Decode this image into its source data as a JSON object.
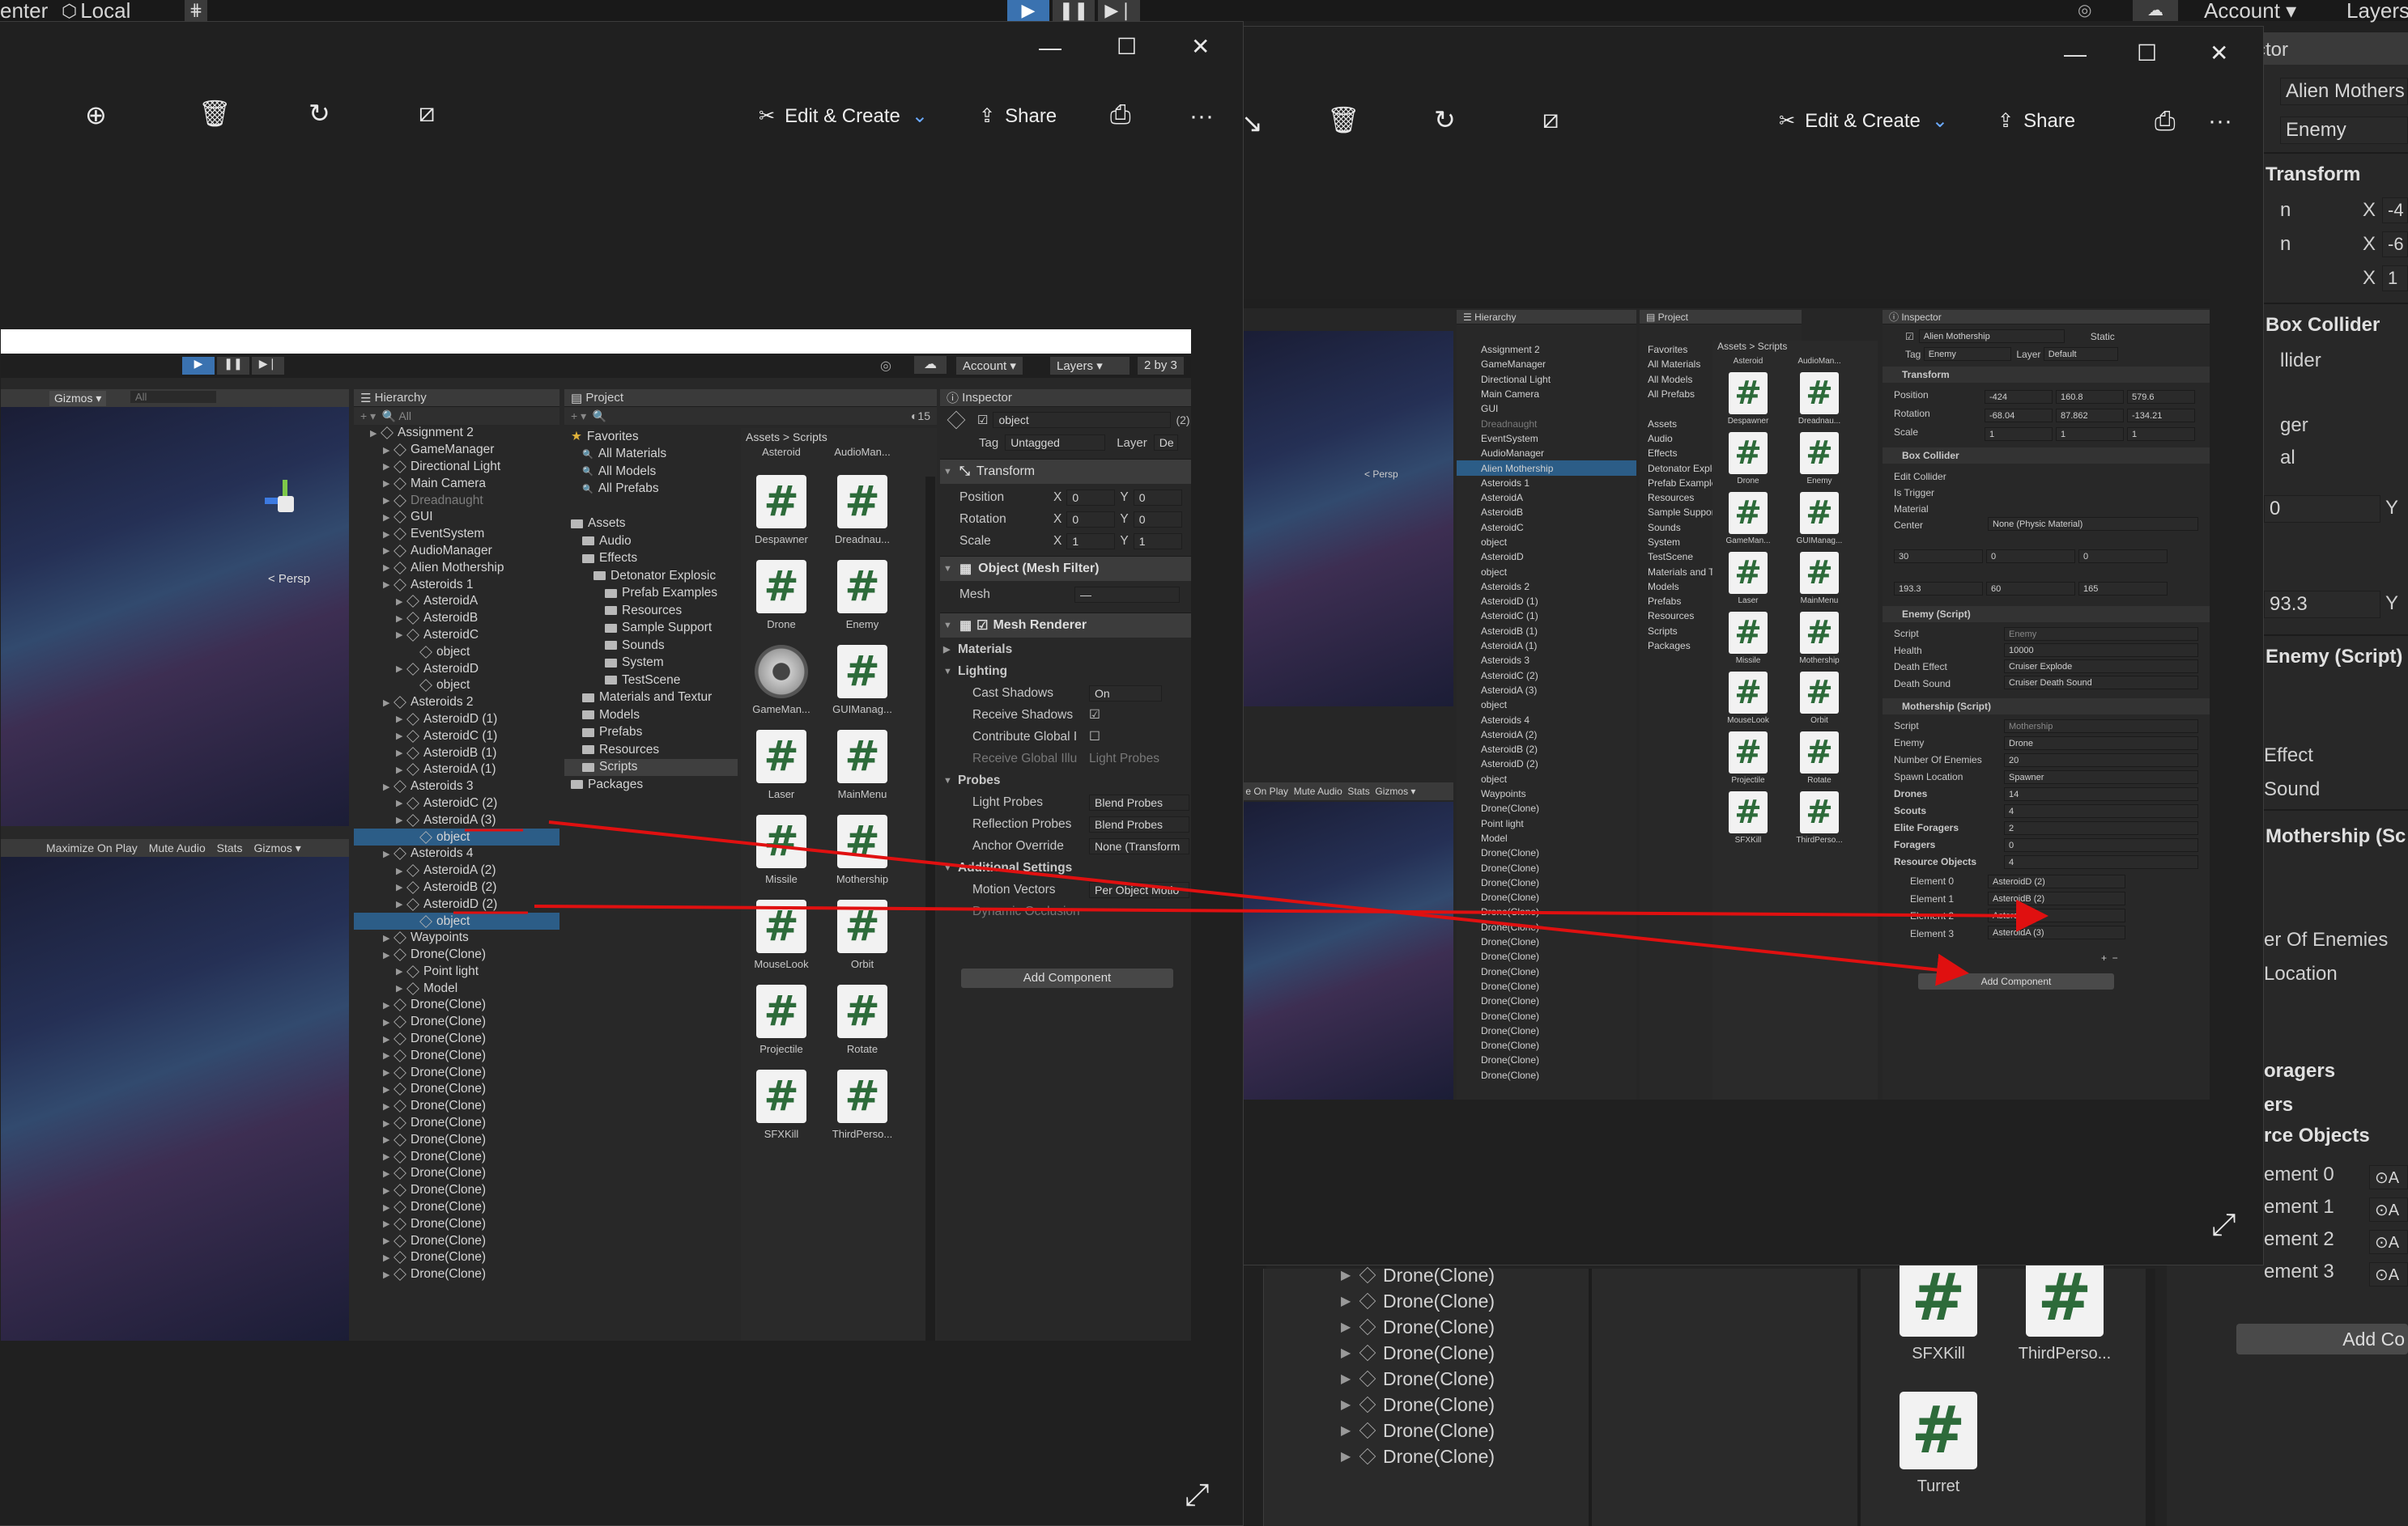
{
  "unity_topbar": {
    "left_items": [
      "enter",
      "Local"
    ],
    "account_label": "Account",
    "layers_label": "Layers"
  },
  "left_viewer": {
    "toolbar": {
      "edit_create": "Edit & Create",
      "share": "Share",
      "more": "···"
    },
    "inner_unity": {
      "account": "Account",
      "layers": "Layers",
      "layout": "2 by 3",
      "gizmos": "Gizmos",
      "search_all": "All",
      "persp": "< Persp",
      "game_bar": [
        "Maximize On Play",
        "Mute Audio",
        "Stats",
        "Gizmos"
      ],
      "hierarchy_title": "Hierarchy",
      "hierarchy": [
        {
          "label": "Assignment 2",
          "depth": 0,
          "type": "scene"
        },
        {
          "label": "GameManager",
          "depth": 1
        },
        {
          "label": "Directional Light",
          "depth": 1
        },
        {
          "label": "Main Camera",
          "depth": 1
        },
        {
          "label": "Dreadnaught",
          "depth": 1,
          "dim": true
        },
        {
          "label": "GUI",
          "depth": 1
        },
        {
          "label": "EventSystem",
          "depth": 1
        },
        {
          "label": "AudioManager",
          "depth": 1
        },
        {
          "label": "Alien Mothership",
          "depth": 1
        },
        {
          "label": "Asteroids 1",
          "depth": 1
        },
        {
          "label": "AsteroidA",
          "depth": 2
        },
        {
          "label": "AsteroidB",
          "depth": 2
        },
        {
          "label": "AsteroidC",
          "depth": 2
        },
        {
          "label": "object",
          "depth": 3
        },
        {
          "label": "AsteroidD",
          "depth": 2
        },
        {
          "label": "object",
          "depth": 3
        },
        {
          "label": "Asteroids 2",
          "depth": 1
        },
        {
          "label": "AsteroidD (1)",
          "depth": 2
        },
        {
          "label": "AsteroidC (1)",
          "depth": 2
        },
        {
          "label": "AsteroidB (1)",
          "depth": 2
        },
        {
          "label": "AsteroidA (1)",
          "depth": 2
        },
        {
          "label": "Asteroids 3",
          "depth": 1
        },
        {
          "label": "AsteroidC (2)",
          "depth": 2
        },
        {
          "label": "AsteroidA (3)",
          "depth": 2
        },
        {
          "label": "object",
          "depth": 3,
          "selected": true
        },
        {
          "label": "Asteroids 4",
          "depth": 1
        },
        {
          "label": "AsteroidA (2)",
          "depth": 2
        },
        {
          "label": "AsteroidB (2)",
          "depth": 2
        },
        {
          "label": "AsteroidD (2)",
          "depth": 2
        },
        {
          "label": "object",
          "depth": 3,
          "selected": true
        },
        {
          "label": "Waypoints",
          "depth": 1
        },
        {
          "label": "Drone(Clone)",
          "depth": 1
        },
        {
          "label": "Point light",
          "depth": 2
        },
        {
          "label": "Model",
          "depth": 2
        },
        {
          "label": "Drone(Clone)",
          "depth": 1
        },
        {
          "label": "Drone(Clone)",
          "depth": 1
        },
        {
          "label": "Drone(Clone)",
          "depth": 1
        },
        {
          "label": "Drone(Clone)",
          "depth": 1
        },
        {
          "label": "Drone(Clone)",
          "depth": 1
        },
        {
          "label": "Drone(Clone)",
          "depth": 1
        },
        {
          "label": "Drone(Clone)",
          "depth": 1
        },
        {
          "label": "Drone(Clone)",
          "depth": 1
        },
        {
          "label": "Drone(Clone)",
          "depth": 1
        },
        {
          "label": "Drone(Clone)",
          "depth": 1
        },
        {
          "label": "Drone(Clone)",
          "depth": 1
        },
        {
          "label": "Drone(Clone)",
          "depth": 1
        },
        {
          "label": "Drone(Clone)",
          "depth": 1
        },
        {
          "label": "Drone(Clone)",
          "depth": 1
        },
        {
          "label": "Drone(Clone)",
          "depth": 1
        },
        {
          "label": "Drone(Clone)",
          "depth": 1
        },
        {
          "label": "Drone(Clone)",
          "depth": 1
        }
      ],
      "project_title": "Project",
      "project_tree": [
        {
          "label": "Favorites",
          "depth": 0,
          "star": true
        },
        {
          "label": "All Materials",
          "depth": 1,
          "search": true
        },
        {
          "label": "All Models",
          "depth": 1,
          "search": true
        },
        {
          "label": "All Prefabs",
          "depth": 1,
          "search": true
        },
        {
          "label": "",
          "depth": 0,
          "blank": true
        },
        {
          "label": "Assets",
          "depth": 0
        },
        {
          "label": "Audio",
          "depth": 1
        },
        {
          "label": "Effects",
          "depth": 1
        },
        {
          "label": "Detonator Explosic",
          "depth": 2
        },
        {
          "label": "Prefab Examples",
          "depth": 3
        },
        {
          "label": "Resources",
          "depth": 3
        },
        {
          "label": "Sample Support",
          "depth": 3
        },
        {
          "label": "Sounds",
          "depth": 3
        },
        {
          "label": "System",
          "depth": 3
        },
        {
          "label": "TestScene",
          "depth": 3
        },
        {
          "label": "Materials and Textur",
          "depth": 1
        },
        {
          "label": "Models",
          "depth": 1
        },
        {
          "label": "Prefabs",
          "depth": 1
        },
        {
          "label": "Resources",
          "depth": 1
        },
        {
          "label": "Scripts",
          "depth": 1,
          "selected": true
        },
        {
          "label": "Packages",
          "depth": 0
        }
      ],
      "breadcrumb": [
        "Assets",
        "Scripts"
      ],
      "asset_count": "15",
      "assets": [
        {
          "label": "Asteroid",
          "kind": "script"
        },
        {
          "label": "AudioMan...",
          "kind": "script"
        },
        {
          "label": "Despawner",
          "kind": "script"
        },
        {
          "label": "Dreadnau...",
          "kind": "script"
        },
        {
          "label": "Drone",
          "kind": "script"
        },
        {
          "label": "Enemy",
          "kind": "script"
        },
        {
          "label": "GameMan...",
          "kind": "gear"
        },
        {
          "label": "GUIManag...",
          "kind": "script"
        },
        {
          "label": "Laser",
          "kind": "script"
        },
        {
          "label": "MainMenu",
          "kind": "script"
        },
        {
          "label": "Missile",
          "kind": "script"
        },
        {
          "label": "Mothership",
          "kind": "script"
        },
        {
          "label": "MouseLook",
          "kind": "script"
        },
        {
          "label": "Orbit",
          "kind": "script"
        },
        {
          "label": "Projectile",
          "kind": "script"
        },
        {
          "label": "Rotate",
          "kind": "script"
        },
        {
          "label": "SFXKill",
          "kind": "script"
        },
        {
          "label": "ThirdPerso...",
          "kind": "script"
        }
      ],
      "inspector": {
        "title": "Inspector",
        "object_name": "object",
        "multi_count": "(2)",
        "tag_label": "Tag",
        "tag_value": "Untagged",
        "layer_label": "Layer",
        "layer_value": "De",
        "transform": "Transform",
        "position": "Position",
        "rotation": "Rotation",
        "scale": "Scale",
        "pos_x": "0",
        "pos_y": "0",
        "rot_x": "0",
        "rot_y": "0",
        "scl_x": "1",
        "scl_y": "1",
        "mesh_filter": "Object (Mesh Filter)",
        "mesh_label": "Mesh",
        "mesh_value": "—",
        "mesh_renderer": "Mesh Renderer",
        "materials": "Materials",
        "lighting": "Lighting",
        "cast_shadows": "Cast Shadows",
        "cast_shadows_val": "On",
        "receive_shadows": "Receive Shadows",
        "contribute_gi": "Contribute Global I",
        "receive_gi": "Receive Global Illu",
        "receive_gi_val": "Light Probes",
        "probes": "Probes",
        "light_probes": "Light Probes",
        "light_probes_val": "Blend Probes",
        "reflection_probes": "Reflection Probes",
        "reflection_probes_val": "Blend Probes",
        "anchor_override": "Anchor Override",
        "anchor_override_val": "None (Transform",
        "additional": "Additional Settings",
        "motion_vectors": "Motion Vectors",
        "motion_vectors_val": "Per Object Motio",
        "dynamic_occlusion": "Dynamic Occlusion",
        "add_component": "Add Component"
      }
    }
  },
  "right_viewer": {
    "toolbar": {
      "edit_create": "Edit & Create",
      "share": "Share",
      "more": "···"
    },
    "mini_hierarchy": [
      "Assignment 2",
      "GameManager",
      "Directional Light",
      "Main Camera",
      "GUI",
      "Dreadnaught",
      "EventSystem",
      "AudioManager",
      "Alien Mothership",
      "Asteroids 1",
      "AsteroidA",
      "AsteroidB",
      "AsteroidC",
      "object",
      "AsteroidD",
      "object",
      "Asteroids 2",
      "AsteroidD (1)",
      "AsteroidC (1)",
      "AsteroidB (1)",
      "AsteroidA (1)",
      "Asteroids 3",
      "AsteroidC (2)",
      "AsteroidA (3)",
      "object",
      "Asteroids 4",
      "AsteroidA (2)",
      "AsteroidB (2)",
      "AsteroidD (2)",
      "object",
      "Waypoints",
      "Drone(Clone)",
      "Point light",
      "Model",
      "Drone(Clone)",
      "Drone(Clone)",
      "Drone(Clone)",
      "Drone(Clone)",
      "Drone(Clone)",
      "Drone(Clone)",
      "Drone(Clone)",
      "Drone(Clone)",
      "Drone(Clone)",
      "Drone(Clone)",
      "Drone(Clone)",
      "Drone(Clone)",
      "Drone(Clone)",
      "Drone(Clone)",
      "Drone(Clone)",
      "Drone(Clone)"
    ],
    "mini_project": [
      "Favorites",
      "All Materials",
      "All Models",
      "All Prefabs",
      "",
      "Assets",
      "Audio",
      "Effects",
      "Detonator Explosic",
      "Prefab Examples",
      "Resources",
      "Sample Support",
      "Sounds",
      "System",
      "TestScene",
      "Materials and Textur",
      "Models",
      "Prefabs",
      "Resources",
      "Scripts",
      "Packages"
    ],
    "mini_assets": [
      "Asteroid",
      "AudioMan...",
      "Despawner",
      "Dreadnau...",
      "Drone",
      "Enemy",
      "GameMan...",
      "GUIManag...",
      "Laser",
      "MainMenu",
      "Missile",
      "Mothership",
      "MouseLook",
      "Orbit",
      "Projectile",
      "Rotate",
      "SFXKill",
      "ThirdPerso..."
    ],
    "mini_inspector": {
      "title": "Inspector",
      "name": "Alien Mothership",
      "static": "Static",
      "tag": "Enemy",
      "layer": "Default",
      "transform": "Transform",
      "position": [
        "-424",
        "160.8",
        "579.6"
      ],
      "rotation": [
        "-68.04",
        "87.862",
        "-134.21"
      ],
      "scale": [
        "1",
        "1",
        "1"
      ],
      "box_collider": "Box Collider",
      "edit_collider": "Edit Collider",
      "is_trigger": "Is Trigger",
      "material": "Material",
      "material_val": "None (Physic Material)",
      "center": "Center",
      "center_vals": [
        "30",
        "0",
        "0"
      ],
      "size": "Size",
      "size_vals": [
        "193.3",
        "60",
        "165"
      ],
      "enemy_script": "Enemy (Script)",
      "script": "Script",
      "enemy_val": "Enemy",
      "health": "Health",
      "health_val": "10000",
      "death_effect": "Death Effect",
      "death_effect_val": "Cruiser Explode",
      "death_sound": "Death Sound",
      "death_sound_val": "Cruiser Death Sound",
      "mothership_script": "Mothership (Script)",
      "mothership_val": "Mothership",
      "enemy": "Enemy",
      "enemy_ref": "Drone",
      "num_enemies": "Number Of Enemies",
      "num_enemies_val": "20",
      "spawn_location": "Spawn Location",
      "spawn_location_val": "Spawner",
      "drones": "Drones",
      "drones_val": "14",
      "scouts": "Scouts",
      "scouts_val": "4",
      "elite": "Elite Foragers",
      "elite_val": "2",
      "foragers": "Foragers",
      "foragers_val": "0",
      "resource_objects": "Resource Objects",
      "resource_objects_val": "4",
      "elements": [
        {
          "label": "Element 0",
          "value": "AsteroidD (2)"
        },
        {
          "label": "Element 1",
          "value": "AsteroidB (2)"
        },
        {
          "label": "Element 2",
          "value": "AsteroidD"
        },
        {
          "label": "Element 3",
          "value": "AsteroidA (3)"
        }
      ],
      "add_component": "Add Component"
    }
  },
  "background_unity": {
    "drones": [
      "Drone(Clone)",
      "Drone(Clone)",
      "Drone(Clone)",
      "Drone(Clone)",
      "Drone(Clone)",
      "Drone(Clone)",
      "Drone(Clone)",
      "Drone(Clone)"
    ],
    "scripts": [
      "SFXKill",
      "ThirdPerso...",
      "Turret"
    ],
    "inspector_fragments": {
      "name": "Alien Mothers",
      "tag": "Enemy",
      "title_tab": "ctor",
      "transform": "Transform",
      "box_collider": "Box Collider",
      "collider_lbls": [
        "llider",
        "ger",
        "al"
      ],
      "x_vals": [
        "-4",
        "-6",
        "1"
      ],
      "field_vals": [
        "0",
        "93.3"
      ],
      "enemy_script": "Enemy (Script)",
      "effect": "Effect",
      "sound": "Sound",
      "mothership_script": "Mothership (Sc",
      "num_enemies": "er Of Enemies",
      "location": "Location",
      "foragers": "oragers",
      "ers": "ers",
      "resource_objects": "rce Objects",
      "elements": [
        "ement 0",
        "ement 1",
        "ement 2",
        "ement 3"
      ],
      "add_c": "Add Co"
    }
  },
  "colors": {
    "arrow": "#e01010",
    "selection": "#2c5d87",
    "play_active": "#3a72b0"
  }
}
